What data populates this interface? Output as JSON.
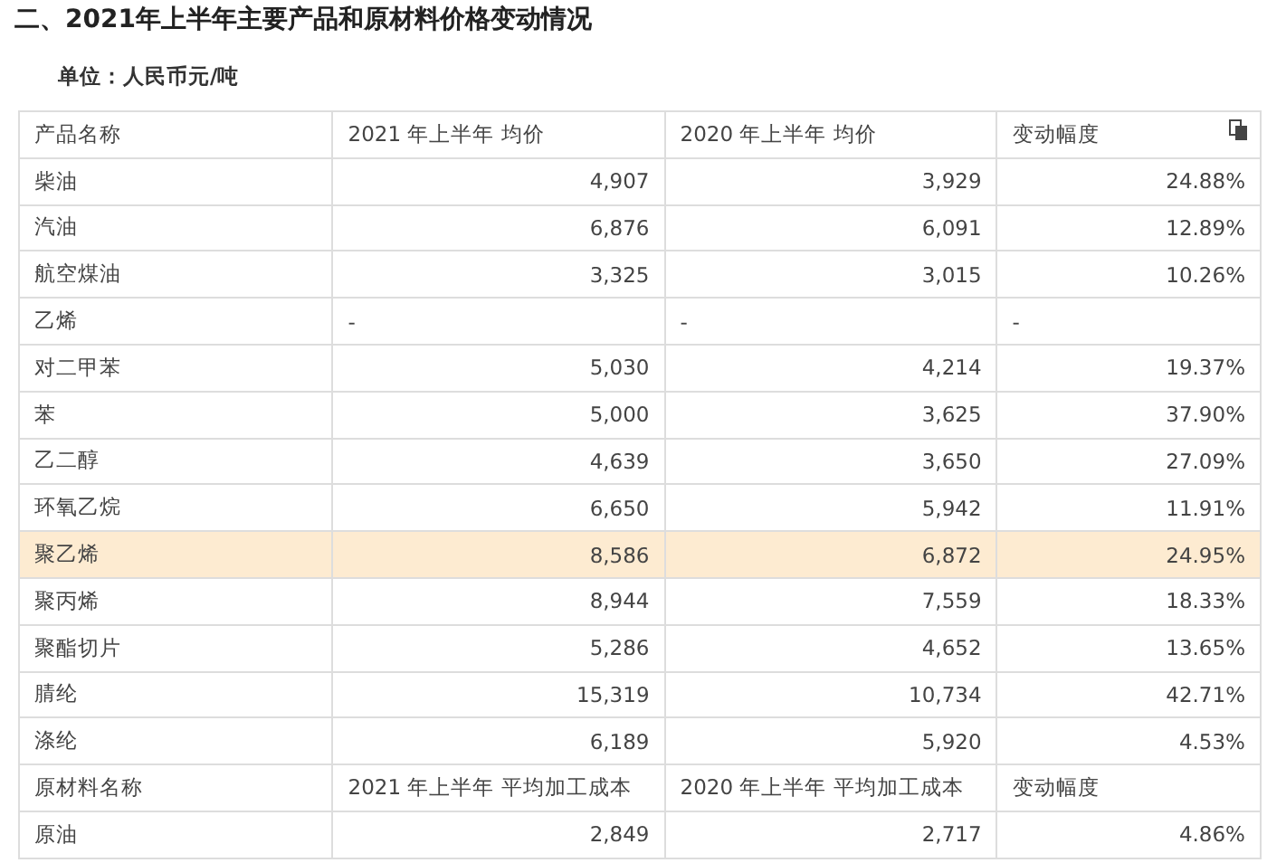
{
  "title": "二、2021年上半年主要产品和原材料价格变动情况",
  "unit": "单位：人民币元/吨",
  "rows": [
    {
      "kind": "header",
      "cells": [
        "产品名称",
        "2021 年上半年 均价",
        "2020 年上半年 均价",
        "变动幅度"
      ],
      "copy_icon": true
    },
    {
      "kind": "data",
      "selected": false,
      "cells": [
        "柴油",
        "4,907",
        "3,929",
        "24.88%"
      ]
    },
    {
      "kind": "data",
      "selected": false,
      "cells": [
        "汽油",
        "6,876",
        "6,091",
        "12.89%"
      ]
    },
    {
      "kind": "data",
      "selected": false,
      "cells": [
        "航空煤油",
        "3,325",
        "3,015",
        "10.26%"
      ]
    },
    {
      "kind": "data",
      "selected": false,
      "cells": [
        "乙烯",
        "-",
        "-",
        "-"
      ],
      "left": true
    },
    {
      "kind": "data",
      "selected": false,
      "cells": [
        "对二甲苯",
        "5,030",
        "4,214",
        "19.37%"
      ]
    },
    {
      "kind": "data",
      "selected": false,
      "cells": [
        "苯",
        "5,000",
        "3,625",
        "37.90%"
      ]
    },
    {
      "kind": "data",
      "selected": false,
      "cells": [
        "乙二醇",
        "4,639",
        "3,650",
        "27.09%"
      ]
    },
    {
      "kind": "data",
      "selected": false,
      "cells": [
        "环氧乙烷",
        "6,650",
        "5,942",
        "11.91%"
      ]
    },
    {
      "kind": "data",
      "selected": true,
      "cells": [
        "聚乙烯",
        "8,586",
        "6,872",
        "24.95%"
      ]
    },
    {
      "kind": "data",
      "selected": false,
      "cells": [
        "聚丙烯",
        "8,944",
        "7,559",
        "18.33%"
      ]
    },
    {
      "kind": "data",
      "selected": false,
      "cells": [
        "聚酯切片",
        "5,286",
        "4,652",
        "13.65%"
      ]
    },
    {
      "kind": "data",
      "selected": false,
      "cells": [
        "腈纶",
        "15,319",
        "10,734",
        "42.71%"
      ]
    },
    {
      "kind": "data",
      "selected": false,
      "cells": [
        "涤纶",
        "6,189",
        "5,920",
        "4.53%"
      ]
    },
    {
      "kind": "header",
      "cells": [
        "原材料名称",
        "2021 年上半年 平均加工成本",
        "2020 年上半年 平均加工成本",
        "变动幅度"
      ],
      "copy_icon": false
    },
    {
      "kind": "data",
      "selected": false,
      "cells": [
        "原油",
        "2,849",
        "2,717",
        "4.86%"
      ]
    }
  ]
}
